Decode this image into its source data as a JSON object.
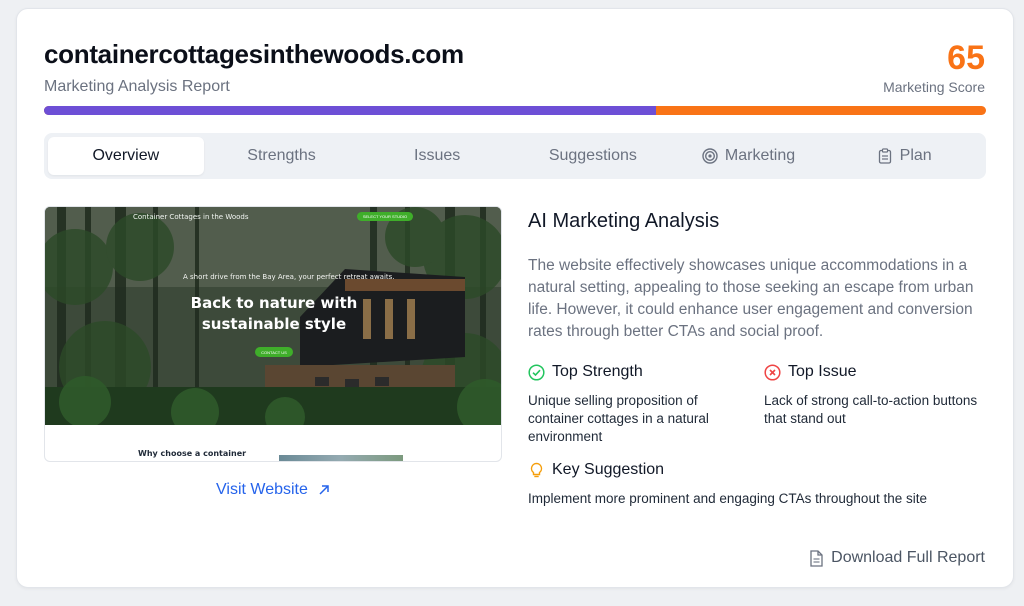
{
  "header": {
    "domain": "containercottagesinthewoods.com",
    "subtitle": "Marketing Analysis Report",
    "score": "65",
    "score_label": "Marketing Score",
    "score_fraction": 0.65,
    "bar_colors": {
      "filled": "#6d4fd6",
      "remaining": "#f97316"
    }
  },
  "tabs": [
    {
      "label": "Overview",
      "active": true
    },
    {
      "label": "Strengths"
    },
    {
      "label": "Issues"
    },
    {
      "label": "Suggestions"
    },
    {
      "label": "Marketing",
      "icon": "target-icon"
    },
    {
      "label": "Plan",
      "icon": "clipboard-icon"
    }
  ],
  "preview": {
    "site_logo": "Container Cottages in the Woods",
    "top_button": "SELECT YOUR STUDIO",
    "tagline": "A short drive from the Bay Area, your perfect retreat awaits.",
    "headline": "Back to nature with sustainable style",
    "cta_button": "CONTACT US",
    "below_heading": "Why choose a container"
  },
  "visit_link": {
    "label": "Visit Website",
    "icon": "external-link-icon"
  },
  "analysis": {
    "title": "AI Marketing Analysis",
    "summary": "The website effectively showcases unique accommodations in a natural setting, appealing to those seeking an escape from urban life. However, it could enhance user engagement and conversion rates through better CTAs and social proof.",
    "top_strength": {
      "heading": "Top Strength",
      "icon": "check-circle-icon",
      "text": "Unique selling proposition of container cottages in a natural environment"
    },
    "top_issue": {
      "heading": "Top Issue",
      "icon": "x-circle-icon",
      "text": "Lack of strong call-to-action buttons that stand out"
    },
    "key_suggestion": {
      "heading": "Key Suggestion",
      "icon": "lightbulb-icon",
      "text": "Implement more prominent and engaging CTAs throughout the site"
    }
  },
  "download": {
    "label": "Download Full Report",
    "icon": "document-icon"
  },
  "colors": {
    "accent_orange": "#f97316",
    "accent_purple": "#6d4fd6",
    "link_blue": "#2563eb",
    "success_green": "#22c55e",
    "error_red": "#ef4444",
    "warning_amber": "#f59e0b"
  }
}
